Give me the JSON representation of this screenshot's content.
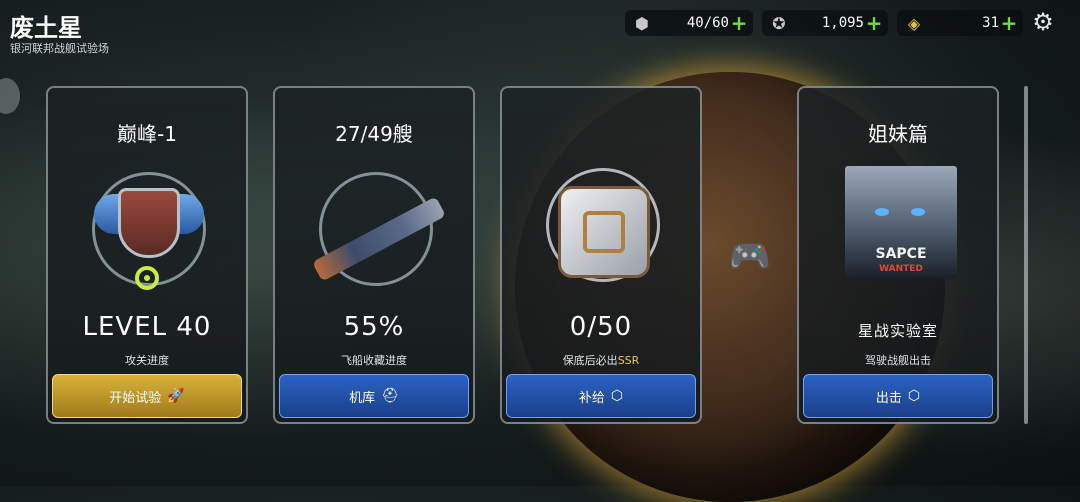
{
  "header": {
    "title": "废土星",
    "subtitle": "银河联邦战舰试验场"
  },
  "resources": [
    {
      "icon": "hexagon-cluster-icon",
      "value": "40/60"
    },
    {
      "icon": "star-coin-icon",
      "value": "1,095"
    },
    {
      "icon": "gem-icon",
      "value": "31"
    }
  ],
  "cards": [
    {
      "title": "巅峰-1",
      "big": "LEVEL 40",
      "caption": "攻关进度",
      "button": "开始试验",
      "button_icon": "rocket-icon",
      "button_style": "gold"
    },
    {
      "title": "27/49艘",
      "big": "55%",
      "caption": "飞船收藏进度",
      "button": "机库",
      "button_icon": "helmet-icon",
      "button_style": "blue"
    },
    {
      "title": "",
      "big": "0/50",
      "caption_prefix": "保底后必出",
      "caption_highlight": "SSR",
      "button": "补给",
      "button_icon": "cube-icon",
      "button_style": "blue"
    },
    {
      "title": "姐妹篇",
      "big": "星战实验室",
      "caption": "驾驶战舰出击",
      "button": "出击",
      "button_icon": "cube-icon",
      "button_style": "blue",
      "poster_line1": "SAPCE",
      "poster_line2": "WANTED"
    }
  ],
  "colors": {
    "plus": "#6fdd3f",
    "gold_button": "#d9b23a",
    "blue_button": "#2b62c4",
    "ssr": "#f0c64a"
  }
}
